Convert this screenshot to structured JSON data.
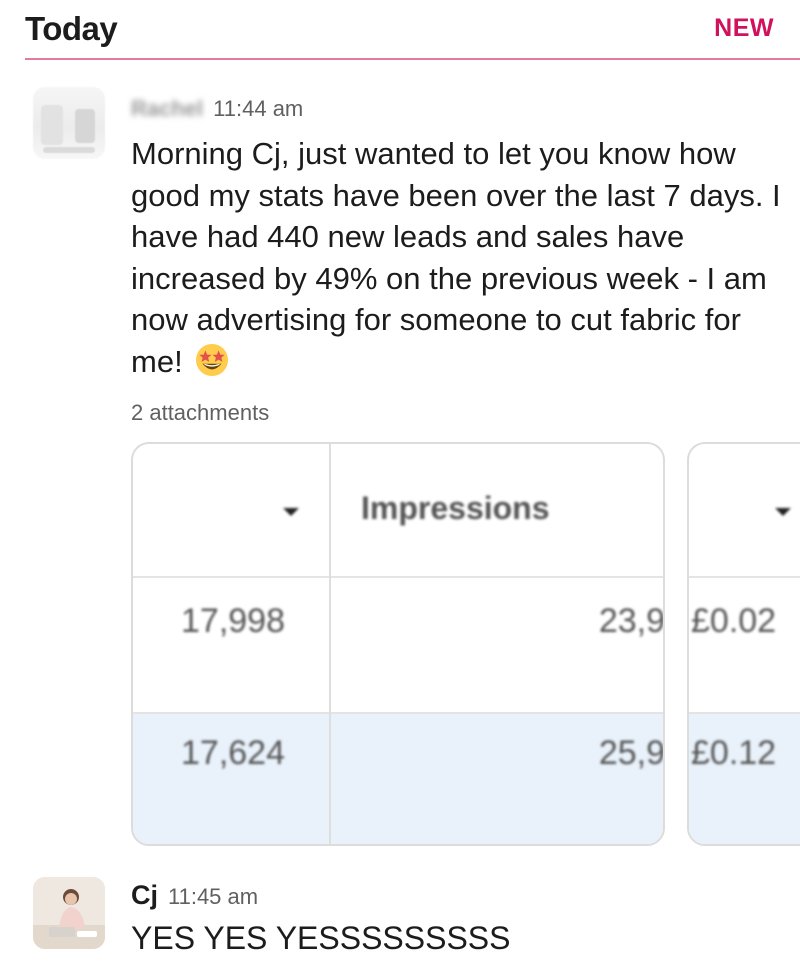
{
  "header": {
    "title": "Today",
    "new_label": "NEW"
  },
  "messages": [
    {
      "sender": "Rachel",
      "time": "11:44 am",
      "text": "Morning Cj, just wanted to let you know how good my stats have been over the last 7 days. I have had 440 new leads and sales have increased by 49% on the previous week - I am now advertising for someone to cut fabric for me!",
      "emoji_name": "star-struck-emoji",
      "attachments_label": "2 attachments",
      "attachments": [
        {
          "header": "Impressions",
          "rows": [
            {
              "results": "17,998",
              "impressions": "23,9"
            },
            {
              "results": "17,624",
              "impressions": "25,9"
            }
          ]
        },
        {
          "rows": [
            {
              "cost": "£0.02"
            },
            {
              "cost": "£0.12"
            }
          ]
        }
      ]
    },
    {
      "sender": "Cj",
      "time": "11:45 am",
      "text": "YES YES YESSSSSSSSS"
    }
  ],
  "colors": {
    "accent": "#d0115e",
    "divider": "#e37aa1",
    "row_highlight": "#e9f2fb"
  }
}
